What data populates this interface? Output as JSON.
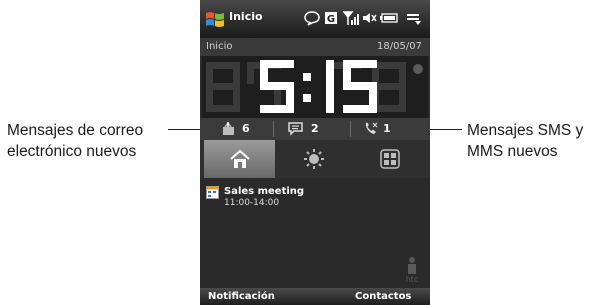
{
  "callouts": {
    "left_line1": "Mensajes de correo",
    "left_line2": "electrónico nuevos",
    "right_line1": "Mensajes SMS y",
    "right_line2": "MMS nuevos"
  },
  "title_bar": {
    "title": "Inicio",
    "icons": [
      "windows-start-icon",
      "chat-icon",
      "g-network-icon",
      "signal-icon",
      "speaker-icon",
      "battery-icon",
      "menu-icon"
    ]
  },
  "header": {
    "label": "Inicio",
    "date": "18/05/07"
  },
  "clock": {
    "time": "5:15",
    "alarm_icon": "alarm-icon"
  },
  "counters": {
    "email": "6",
    "sms": "2",
    "missed_calls": "1"
  },
  "tabs": [
    {
      "name": "home",
      "icon": "home-icon",
      "active": true
    },
    {
      "name": "weather",
      "icon": "sun-icon",
      "active": false
    },
    {
      "name": "launcher",
      "icon": "grid-icon",
      "active": false
    }
  ],
  "appointment": {
    "title": "Sales meeting",
    "time": "11:00-14:00"
  },
  "softkeys": {
    "left": "Notificación",
    "right": "Contactos"
  },
  "colors": {
    "background": "#2b2b2b",
    "clock_digits": "#ffffff",
    "clock_ghost": "#3a3a3a"
  }
}
